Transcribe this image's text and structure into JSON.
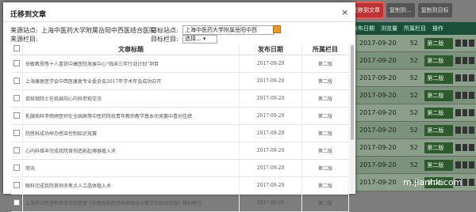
{
  "background": {
    "toolbar": [
      "迁移到文章",
      "复制到...",
      "复制到目标"
    ],
    "header": [
      "发布日期",
      "浏览量",
      "所属栏目",
      "操作"
    ],
    "rows": [
      {
        "date": "2017-09-20",
        "n": "52",
        "col": "第二版"
      },
      {
        "date": "2017-09-20",
        "n": "52",
        "col": "第二版"
      },
      {
        "date": "2017-09-20",
        "n": "52",
        "col": "第二版"
      },
      {
        "date": "2017-09-20",
        "n": "52",
        "col": "第二版"
      },
      {
        "date": "2017-09-20",
        "n": "52",
        "col": "第二版"
      },
      {
        "date": "2017-09-20",
        "n": "52",
        "col": "第二版"
      },
      {
        "date": "2017-09-20",
        "n": "52",
        "col": "第二版"
      },
      {
        "date": "2017-09-20",
        "n": "52",
        "col": "第二版"
      },
      {
        "date": "2017-09-20",
        "n": "52",
        "col": "第二版"
      }
    ]
  },
  "dialog": {
    "title": "迁移到文章",
    "close": "×",
    "source_site_label": "来源站点:",
    "source_site_value": "上海中医药大学附属岳阳中西医结合医院",
    "target_site_label": "目标站点:",
    "target_site_value": "上海中医药大学附属岳阳中西",
    "source_col_label": "来源栏目:",
    "target_col_label": "目标栏目:",
    "target_col_value": "选择...",
    "table": {
      "headers": [
        "文章标题",
        "发布日期",
        "所属栏目"
      ],
      "rows": [
        {
          "title": "岳敏教授等十人喜获中康医院发展中心“临床三年行动计划”项目",
          "date": "2017-09-20",
          "col": "第二版"
        },
        {
          "title": "上海康复医学会中西医康复专业委员会2017年学术年会成功召开",
          "date": "2017-09-20",
          "col": "第二版"
        },
        {
          "title": "荔枝观院士在临县阳心内科参观交流",
          "date": "2017-09-20",
          "col": "第二版"
        },
        {
          "title": "乳腺病科李雨婷医师在全国高等中医药院校青年教师教学基本功竞赛中喜创佳绩",
          "date": "2017-09-20",
          "col": "第二版"
        },
        {
          "title": "院感科成功举办感染控制知识竞赛",
          "date": "2017-09-20",
          "col": "第二版"
        },
        {
          "title": "心内科维丰完成我院首例造影起搏器植入术",
          "date": "2017-09-20",
          "col": "第二版"
        },
        {
          "title": "简讯",
          "date": "2017-09-20",
          "col": "第二版"
        },
        {
          "title": "眼科完成我院首例多焦点人工晶体植入术",
          "date": "2017-09-20",
          "col": "第二版"
        },
        {
          "title": "上海市中医全科师资培训班暨《中医全科医师培养临床与教学实践培训班》顺利举行",
          "date": "2017-09-20",
          "col": "第二版"
        }
      ]
    }
  },
  "watermark": "m.jianhk.com",
  "colors": {
    "move_button": "#b33333",
    "header_green": "#1b4f3a"
  }
}
